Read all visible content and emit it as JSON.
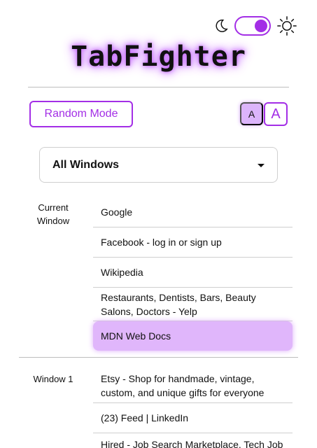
{
  "header": {
    "title": "TabFighter",
    "theme_toggle": {
      "state": "dark"
    },
    "icons": {
      "moon": "moon-icon",
      "sun": "sun-icon"
    },
    "accent_color": "#a32ee6"
  },
  "controls": {
    "random_mode_label": "Random Mode",
    "font_small_label": "A",
    "font_large_label": "A"
  },
  "window_select": {
    "value": "All Windows"
  },
  "groups": [
    {
      "label": "Current Window",
      "tabs": [
        {
          "title": "Google",
          "active": false
        },
        {
          "title": "Facebook - log in or sign up",
          "active": false
        },
        {
          "title": "Wikipedia",
          "active": false
        },
        {
          "title": "Restaurants, Dentists, Bars, Beauty Salons, Doctors - Yelp",
          "active": false
        },
        {
          "title": "MDN Web Docs",
          "active": true
        }
      ]
    },
    {
      "label": "Window 1",
      "tabs": [
        {
          "title": "Etsy - Shop for handmade, vintage, custom, and unique gifts for everyone",
          "active": false
        },
        {
          "title": "(23) Feed | LinkedIn",
          "active": false
        },
        {
          "title": "Hired - Job Search Marketplace. Tech Job",
          "active": false
        }
      ]
    }
  ]
}
